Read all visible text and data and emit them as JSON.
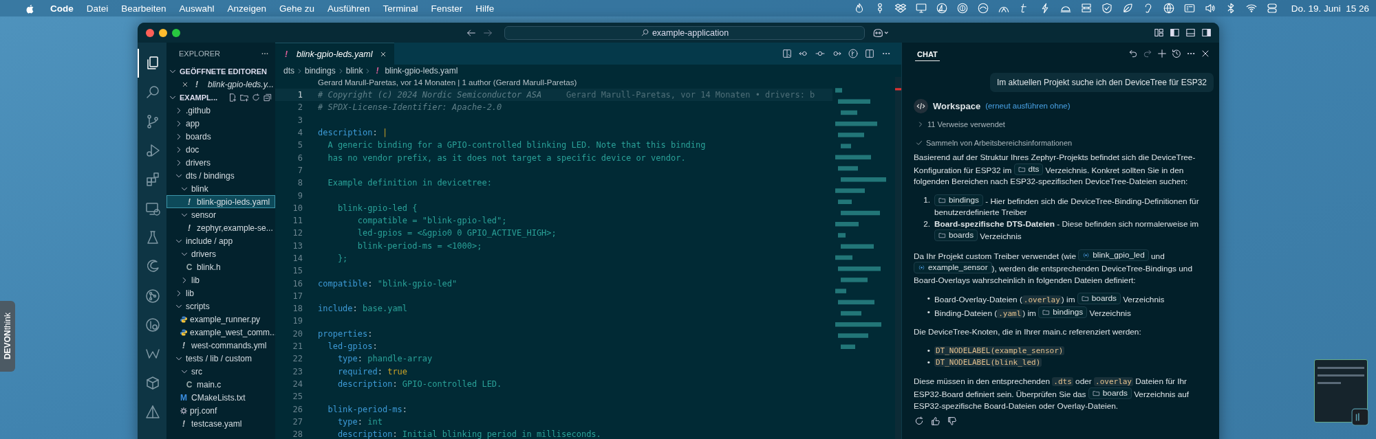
{
  "menu_bar": {
    "app": "Code",
    "items": [
      "Datei",
      "Bearbeiten",
      "Auswahl",
      "Anzeigen",
      "Gehe zu",
      "Ausführen",
      "Terminal",
      "Fenster",
      "Hilfe"
    ],
    "clock": "Do. 19. Juni  15 26"
  },
  "title_bar": {
    "search": "example-application"
  },
  "activity_bar": [
    {
      "kind": "files",
      "selected": true
    },
    {
      "kind": "search",
      "selected": false
    },
    {
      "kind": "scm",
      "selected": false
    },
    {
      "kind": "debug",
      "selected": false
    },
    {
      "kind": "extensions",
      "selected": false
    },
    {
      "kind": "remote",
      "selected": false
    },
    {
      "kind": "testing",
      "selected": false
    },
    {
      "kind": "swirl",
      "selected": false
    },
    {
      "kind": "graph",
      "selected": false
    },
    {
      "kind": "lens",
      "selected": false
    },
    {
      "kind": "w",
      "selected": false
    },
    {
      "kind": "box",
      "selected": false
    },
    {
      "kind": "pyramid",
      "selected": false
    }
  ],
  "explorer": {
    "title": "EXPLORER",
    "open_editors": {
      "label": "GEÖFFNETE EDITOREN",
      "expanded": true,
      "items": [
        {
          "icon": "!",
          "name": "blink-gpio-leds.y..."
        }
      ]
    },
    "workspace": {
      "label": "EXAMPL...",
      "expanded": true
    },
    "tree": [
      {
        "name": ".github",
        "kind": "folder",
        "expanded": false,
        "selected": false
      },
      {
        "name": "app",
        "kind": "folder",
        "expanded": false,
        "selected": false
      },
      {
        "name": "boards",
        "kind": "folder",
        "expanded": false,
        "selected": false
      },
      {
        "name": "doc",
        "kind": "folder",
        "expanded": false,
        "selected": false
      },
      {
        "name": "drivers",
        "kind": "folder",
        "expanded": false,
        "selected": false
      },
      {
        "name": "dts / bindings",
        "kind": "folder",
        "expanded": true,
        "selected": false,
        "children": [
          {
            "name": "blink",
            "kind": "folder",
            "expanded": true,
            "selected": false,
            "children": [
              {
                "name": "blink-gpio-leds.yaml",
                "kind": "yaml",
                "icon": "!",
                "selected": true
              }
            ]
          },
          {
            "name": "sensor",
            "kind": "folder",
            "expanded": true,
            "selected": false,
            "children": [
              {
                "name": "zephyr,example-se...",
                "kind": "yaml",
                "icon": "!",
                "selected": false
              }
            ]
          }
        ]
      },
      {
        "name": "include / app",
        "kind": "folder",
        "expanded": true,
        "selected": false,
        "children": [
          {
            "name": "drivers",
            "kind": "folder",
            "expanded": true,
            "selected": false,
            "children": [
              {
                "name": "blink.h",
                "kind": "c",
                "icon": "C",
                "selected": false
              }
            ]
          },
          {
            "name": "lib",
            "kind": "folder",
            "expanded": false,
            "selected": false
          }
        ]
      },
      {
        "name": "lib",
        "kind": "folder",
        "expanded": false,
        "selected": false
      },
      {
        "name": "scripts",
        "kind": "folder",
        "expanded": true,
        "selected": false,
        "children": [
          {
            "name": "example_runner.py",
            "kind": "py",
            "selected": false
          },
          {
            "name": "example_west_comm...",
            "kind": "py",
            "selected": false
          },
          {
            "name": "west-commands.yml",
            "kind": "yaml",
            "icon": "!",
            "selected": false
          }
        ]
      },
      {
        "name": "tests / lib / custom",
        "kind": "folder",
        "expanded": true,
        "selected": false,
        "children": [
          {
            "name": "src",
            "kind": "folder",
            "expanded": true,
            "selected": false,
            "children": [
              {
                "name": "main.c",
                "kind": "c",
                "icon": "C",
                "selected": false
              }
            ]
          },
          {
            "name": "CMakeLists.txt",
            "kind": "cmake",
            "icon": "M",
            "selected": false
          },
          {
            "name": "prj.conf",
            "kind": "conf",
            "selected": false
          },
          {
            "name": "testcase.yaml",
            "kind": "yaml",
            "icon": "!",
            "selected": false
          }
        ]
      }
    ]
  },
  "editor": {
    "tabs": [
      {
        "icon": "!",
        "label": "blink-gpio-leds.yaml",
        "selected": true
      }
    ],
    "breadcrumbs": [
      {
        "text": "dts"
      },
      {
        "text": "bindings"
      },
      {
        "text": "blink"
      },
      {
        "text": "blink-gpio-leds.yaml",
        "icon": "!"
      }
    ],
    "blame_header": "Gerard Marull-Paretas, vor 14 Monaten | 1 author (Gerard Marull-Paretas)",
    "lines": [
      {
        "number": "1",
        "current": true,
        "tokens": [
          {
            "kind": "comment",
            "text": "# Copyright (c) 2024 Nordic Semiconductor ASA"
          }
        ],
        "blame": "Gerard Marull-Paretas, vor 14 Monaten • drivers: b"
      },
      {
        "number": "2",
        "current": false,
        "tokens": [
          {
            "kind": "comment",
            "text": "# SPDX-License-Identifier: Apache-2.0"
          }
        ]
      },
      {
        "number": "3",
        "current": false
      },
      {
        "number": "4",
        "current": false,
        "tokens": [
          {
            "kind": "key",
            "text": "description"
          },
          {
            "kind": "punct",
            "text": ": "
          },
          {
            "kind": "bool",
            "text": "|"
          }
        ]
      },
      {
        "number": "5",
        "current": false,
        "tokens": [
          {
            "kind": "string",
            "text": "  A generic binding for a GPIO-controlled blinking LED. Note that this binding"
          }
        ]
      },
      {
        "number": "6",
        "current": false,
        "tokens": [
          {
            "kind": "string",
            "text": "  has no vendor prefix, as it does not target a specific device or vendor."
          }
        ]
      },
      {
        "number": "7",
        "current": false
      },
      {
        "number": "8",
        "current": false,
        "tokens": [
          {
            "kind": "string",
            "text": "  Example definition in devicetree:"
          }
        ]
      },
      {
        "number": "9",
        "current": false
      },
      {
        "number": "10",
        "current": false,
        "tokens": [
          {
            "kind": "string",
            "text": "    blink-gpio-led {"
          }
        ]
      },
      {
        "number": "11",
        "current": false,
        "tokens": [
          {
            "kind": "string",
            "text": "        compatible = \"blink-gpio-led\";"
          }
        ]
      },
      {
        "number": "12",
        "current": false,
        "tokens": [
          {
            "kind": "string",
            "text": "        led-gpios = <&gpio0 0 GPIO_ACTIVE_HIGH>;"
          }
        ]
      },
      {
        "number": "13",
        "current": false,
        "tokens": [
          {
            "kind": "string",
            "text": "        blink-period-ms = <1000>;"
          }
        ]
      },
      {
        "number": "14",
        "current": false,
        "tokens": [
          {
            "kind": "string",
            "text": "    };"
          }
        ]
      },
      {
        "number": "15",
        "current": false
      },
      {
        "number": "16",
        "current": false,
        "tokens": [
          {
            "kind": "key",
            "text": "compatible"
          },
          {
            "kind": "punct",
            "text": ": "
          },
          {
            "kind": "string",
            "text": "\"blink-gpio-led\""
          }
        ]
      },
      {
        "number": "17",
        "current": false
      },
      {
        "number": "18",
        "current": false,
        "tokens": [
          {
            "kind": "key",
            "text": "include"
          },
          {
            "kind": "punct",
            "text": ": "
          },
          {
            "kind": "string",
            "text": "base.yaml"
          }
        ]
      },
      {
        "number": "19",
        "current": false
      },
      {
        "number": "20",
        "current": false,
        "tokens": [
          {
            "kind": "key",
            "text": "properties"
          },
          {
            "kind": "punct",
            "text": ":"
          }
        ]
      },
      {
        "number": "21",
        "current": false,
        "tokens": [
          {
            "kind": "key",
            "text": "  led-gpios"
          },
          {
            "kind": "punct",
            "text": ":"
          }
        ]
      },
      {
        "number": "22",
        "current": false,
        "tokens": [
          {
            "kind": "key",
            "text": "    type"
          },
          {
            "kind": "punct",
            "text": ": "
          },
          {
            "kind": "string",
            "text": "phandle-array"
          }
        ]
      },
      {
        "number": "23",
        "current": false,
        "tokens": [
          {
            "kind": "key",
            "text": "    required"
          },
          {
            "kind": "punct",
            "text": ": "
          },
          {
            "kind": "bool",
            "text": "true"
          }
        ]
      },
      {
        "number": "24",
        "current": false,
        "tokens": [
          {
            "kind": "key",
            "text": "    description"
          },
          {
            "kind": "punct",
            "text": ": "
          },
          {
            "kind": "string",
            "text": "GPIO-controlled LED."
          }
        ]
      },
      {
        "number": "25",
        "current": false
      },
      {
        "number": "26",
        "current": false,
        "tokens": [
          {
            "kind": "key",
            "text": "  blink-period-ms"
          },
          {
            "kind": "punct",
            "text": ":"
          }
        ]
      },
      {
        "number": "27",
        "current": false,
        "tokens": [
          {
            "kind": "key",
            "text": "    type"
          },
          {
            "kind": "punct",
            "text": ": "
          },
          {
            "kind": "string",
            "text": "int"
          }
        ]
      },
      {
        "number": "28",
        "current": false,
        "tokens": [
          {
            "kind": "key",
            "text": "    description"
          },
          {
            "kind": "punct",
            "text": ": "
          },
          {
            "kind": "string",
            "text": "Initial blinking period in milliseconds."
          }
        ]
      }
    ]
  },
  "chat": {
    "tabs": [
      {
        "label": "CHAT",
        "selected": true
      }
    ],
    "user_message": "Im aktuellen Projekt suche ich den DeviceTree für ESP32",
    "response": {
      "agent": "Workspace",
      "rerun_link": "(erneut ausführen ohne)",
      "references": {
        "label": "11 Verweise verwendet",
        "expanded": false
      },
      "progress": {
        "label": "Sammeln von Arbeitsbereichsinformationen",
        "done": true
      },
      "blocks": [
        {
          "kind": "paragraph",
          "parts": [
            {
              "kind": "text",
              "text": "Basierend auf der Struktur Ihres Zephyr-Projekts befindet sich die DeviceTree-Konfiguration für ESP32 im "
            },
            {
              "kind": "folder",
              "text": "dts"
            },
            {
              "kind": "text",
              "text": " Verzeichnis. Konkret sollten Sie in den folgenden Bereichen nach ESP32-spezifischen DeviceTree-Dateien suchen:"
            }
          ]
        },
        {
          "kind": "list",
          "items": [
            {
              "marker": "1.",
              "parts": [
                {
                  "kind": "folder",
                  "text": "bindings"
                },
                {
                  "kind": "text",
                  "text": " - Hier befinden sich die DeviceTree-Binding-Definitionen für benutzerdefinierte Treiber"
                }
              ]
            },
            {
              "marker": "2.",
              "parts": [
                {
                  "kind": "text",
                  "text": "**Board-spezifische DTS-Dateien** - Diese befinden sich normalerweise im "
                },
                {
                  "kind": "folder",
                  "text": "boards"
                },
                {
                  "kind": "text",
                  "text": " Verzeichnis"
                }
              ]
            }
          ]
        },
        {
          "kind": "paragraph",
          "parts": [
            {
              "kind": "text",
              "text": "Da Ihr Projekt custom Treiber verwendet (wie "
            },
            {
              "kind": "symbol",
              "text": "blink_gpio_led"
            },
            {
              "kind": "text",
              "text": " und "
            },
            {
              "kind": "symbol",
              "text": "example_sensor"
            },
            {
              "kind": "text",
              "text": "), werden die entsprechenden DeviceTree-Bindings und Board-Overlays wahrscheinlich in folgenden Dateien definiert:"
            }
          ]
        },
        {
          "kind": "list",
          "items": [
            {
              "marker": "•",
              "parts": [
                {
                  "kind": "text",
                  "text": "Board-Overlay-Dateien ("
                },
                {
                  "kind": "code",
                  "text": ".overlay"
                },
                {
                  "kind": "text",
                  "text": ") im "
                },
                {
                  "kind": "folder",
                  "text": "boards"
                },
                {
                  "kind": "text",
                  "text": " Verzeichnis"
                }
              ]
            },
            {
              "marker": "•",
              "parts": [
                {
                  "kind": "text",
                  "text": "Binding-Dateien ("
                },
                {
                  "kind": "code",
                  "text": ".yaml"
                },
                {
                  "kind": "text",
                  "text": ") im "
                },
                {
                  "kind": "folder",
                  "text": "bindings"
                },
                {
                  "kind": "text",
                  "text": " Verzeichnis"
                }
              ]
            }
          ]
        },
        {
          "kind": "paragraph",
          "parts": [
            {
              "kind": "text",
              "text": "Die DeviceTree-Knoten, die in Ihrer main.c referenziert werden:"
            }
          ]
        },
        {
          "kind": "list",
          "items": [
            {
              "marker": "•",
              "parts": [
                {
                  "kind": "code",
                  "text": "DT_NODELABEL(example_sensor)"
                }
              ]
            },
            {
              "marker": "•",
              "parts": [
                {
                  "kind": "code",
                  "text": "DT_NODELABEL(blink_led)"
                }
              ]
            }
          ]
        },
        {
          "kind": "paragraph",
          "parts": [
            {
              "kind": "text",
              "text": "Diese müssen in den entsprechenden "
            },
            {
              "kind": "code",
              "text": ".dts"
            },
            {
              "kind": "text",
              "text": " oder "
            },
            {
              "kind": "code",
              "text": ".overlay"
            },
            {
              "kind": "text",
              "text": " Dateien für Ihr ESP32-Board definiert sein. Überprüfen Sie das "
            },
            {
              "kind": "folder",
              "text": "boards"
            },
            {
              "kind": "text",
              "text": " Verzeichnis auf ESP32-spezifische Board-Dateien oder Overlay-Dateien."
            }
          ]
        }
      ]
    }
  },
  "dock_tab": {
    "label": "**DEVON**think"
  }
}
